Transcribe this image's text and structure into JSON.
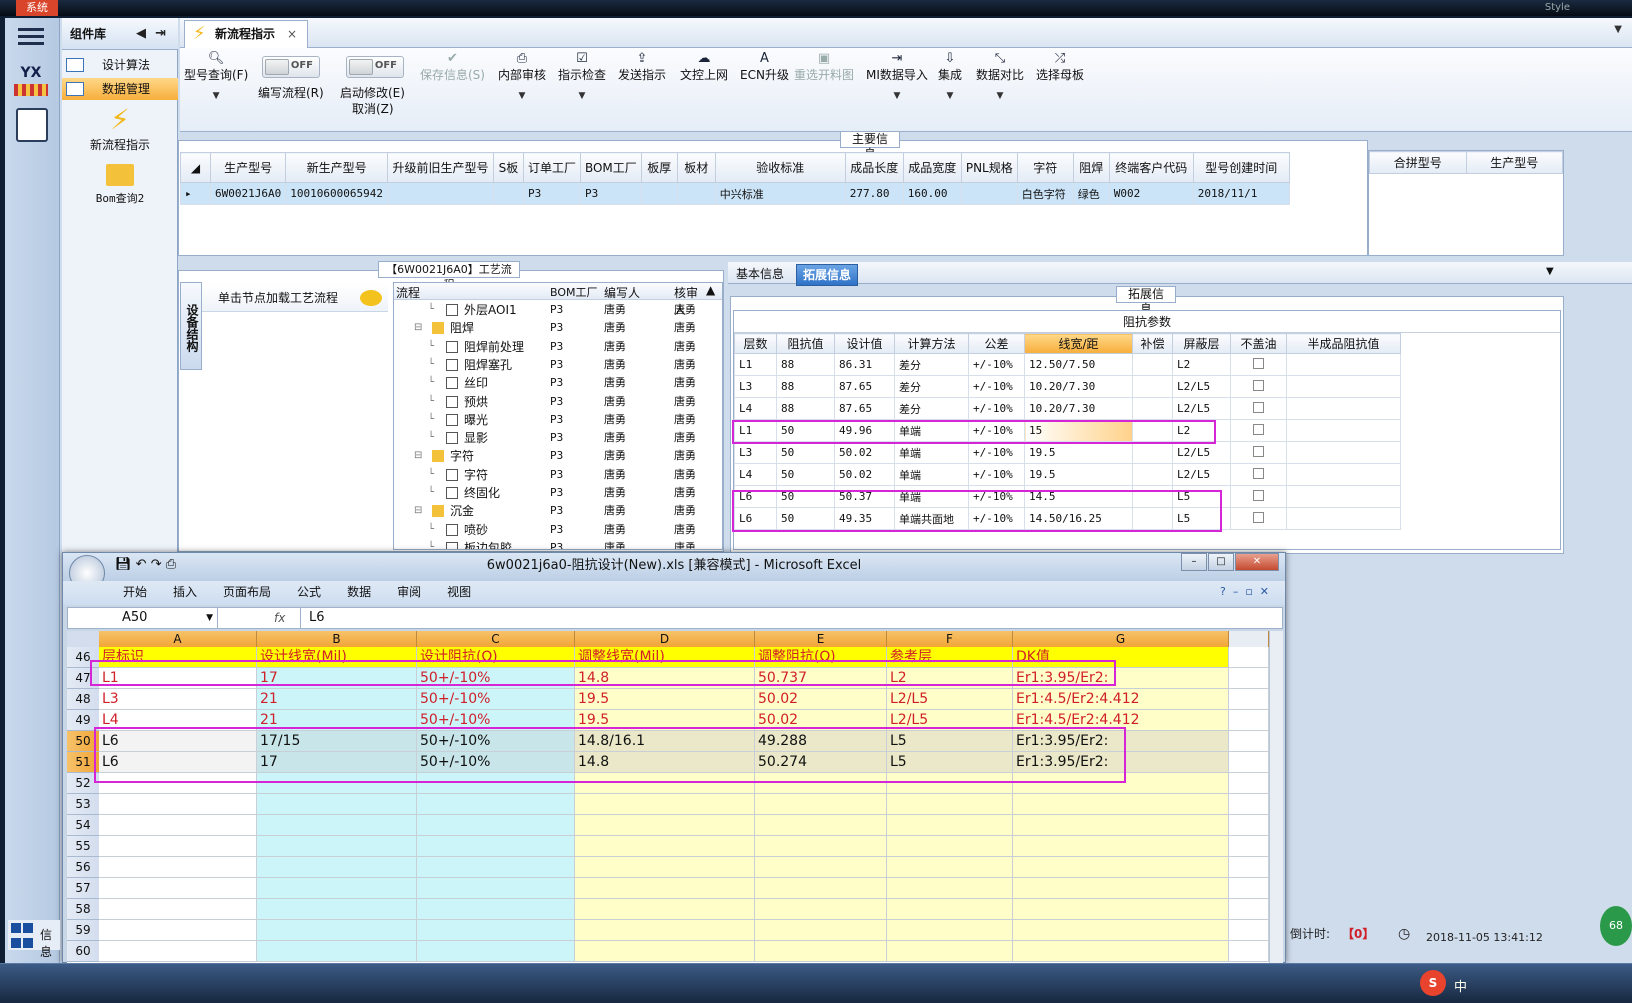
{
  "system_tag": "系统",
  "system_right": "Style",
  "left_rail": {
    "logo": "YX"
  },
  "component_lib": {
    "title": "组件库",
    "items": [
      {
        "label": "设计算法"
      },
      {
        "label": "数据管理"
      }
    ],
    "big_buttons": [
      {
        "label": "新流程指示"
      },
      {
        "label": "Bom查询2"
      }
    ]
  },
  "tab": {
    "label": "新流程指示",
    "close": "×"
  },
  "toolbar": {
    "buttons": [
      {
        "label": "型号查询(F)",
        "icon": "search-icon",
        "dropdown": true,
        "disabled": false
      },
      {
        "label": "保存信息(S)",
        "icon": "check-icon",
        "dropdown": false,
        "disabled": true
      },
      {
        "label": "内部审核",
        "icon": "print-icon",
        "dropdown": true,
        "disabled": false
      },
      {
        "label": "指示检查",
        "icon": "check-box-icon",
        "dropdown": true,
        "disabled": false
      },
      {
        "label": "发送指示",
        "icon": "upload-icon",
        "dropdown": false,
        "disabled": false
      },
      {
        "label": "文控上网",
        "icon": "cloud-upload-icon",
        "dropdown": false,
        "disabled": false
      },
      {
        "label": "ECN升级",
        "icon": "font-icon",
        "dropdown": false,
        "disabled": false
      },
      {
        "label": "重选开料图",
        "icon": "image-icon",
        "dropdown": false,
        "disabled": true
      },
      {
        "label": "MI数据导入",
        "icon": "import-icon",
        "dropdown": true,
        "disabled": false
      },
      {
        "label": "集成",
        "icon": "download-icon",
        "dropdown": true,
        "disabled": false
      },
      {
        "label": "数据对比",
        "icon": "compare-icon",
        "dropdown": true,
        "disabled": false
      },
      {
        "label": "选择母板",
        "icon": "shuffle-icon",
        "dropdown": false,
        "disabled": false
      }
    ],
    "toggles": [
      {
        "label": "编写流程(R)",
        "state": "OFF"
      },
      {
        "label": "启动修改(E)",
        "sub": "取消(Z)",
        "state": "OFF"
      }
    ]
  },
  "main_info": {
    "title": "主要信息",
    "columns": [
      "生产型号",
      "新生产型号",
      "升级前旧生产型号",
      "S板",
      "订单工厂",
      "BOM工厂",
      "板厚",
      "板材",
      "验收标准",
      "成品长度",
      "成品宽度",
      "PNL规格",
      "字符",
      "阻焊",
      "终端客户代码",
      "型号创建时间"
    ],
    "row": [
      "6W0021J6A0",
      "10010600065942",
      "",
      "",
      "P3",
      "P3",
      "",
      "",
      "中兴标准",
      "277.80",
      "160.00",
      "",
      "白色字符",
      "绿色",
      "W002",
      "2018/11/1"
    ],
    "side_columns": [
      "合拼型号",
      "生产型号"
    ]
  },
  "process": {
    "title": "【6W0021J6A0】工艺流程",
    "vertical_tab": "设备结构",
    "hint": "单击节点加载工艺流程",
    "tree_columns": [
      "流程",
      "BOM工厂",
      "编写人",
      "核审人"
    ],
    "rows": [
      {
        "name": "外层AOI1",
        "level": 2,
        "type": "doc",
        "bom": "P3",
        "writer": "唐勇",
        "reviewer": "唐勇"
      },
      {
        "name": "阻焊",
        "level": 1,
        "type": "folder",
        "bom": "P3",
        "writer": "唐勇",
        "reviewer": "唐勇"
      },
      {
        "name": "阻焊前处理",
        "level": 2,
        "type": "doc",
        "bom": "P3",
        "writer": "唐勇",
        "reviewer": "唐勇"
      },
      {
        "name": "阻焊塞孔",
        "level": 2,
        "type": "doc",
        "bom": "P3",
        "writer": "唐勇",
        "reviewer": "唐勇"
      },
      {
        "name": "丝印",
        "level": 2,
        "type": "doc",
        "bom": "P3",
        "writer": "唐勇",
        "reviewer": "唐勇"
      },
      {
        "name": "预烘",
        "level": 2,
        "type": "doc",
        "bom": "P3",
        "writer": "唐勇",
        "reviewer": "唐勇"
      },
      {
        "name": "曝光",
        "level": 2,
        "type": "doc",
        "bom": "P3",
        "writer": "唐勇",
        "reviewer": "唐勇"
      },
      {
        "name": "显影",
        "level": 2,
        "type": "doc",
        "bom": "P3",
        "writer": "唐勇",
        "reviewer": "唐勇"
      },
      {
        "name": "字符",
        "level": 1,
        "type": "folder",
        "bom": "P3",
        "writer": "唐勇",
        "reviewer": "唐勇"
      },
      {
        "name": "字符",
        "level": 2,
        "type": "doc",
        "bom": "P3",
        "writer": "唐勇",
        "reviewer": "唐勇"
      },
      {
        "name": "终固化",
        "level": 2,
        "type": "doc",
        "bom": "P3",
        "writer": "唐勇",
        "reviewer": "唐勇"
      },
      {
        "name": "沉金",
        "level": 1,
        "type": "folder",
        "bom": "P3",
        "writer": "唐勇",
        "reviewer": "唐勇"
      },
      {
        "name": "喷砂",
        "level": 2,
        "type": "doc",
        "bom": "P3",
        "writer": "唐勇",
        "reviewer": "唐勇"
      },
      {
        "name": "板边包胶",
        "level": 2,
        "type": "doc",
        "bom": "P3",
        "writer": "唐勇",
        "reviewer": "唐勇"
      }
    ]
  },
  "extended": {
    "tabs": [
      "基本信息",
      "拓展信息"
    ],
    "active_tab": 1,
    "title": "拓展信息",
    "impedance_title": "阻抗参数",
    "columns": [
      "层数",
      "阻抗值",
      "设计值",
      "计算方法",
      "公差",
      "线宽/距",
      "补偿",
      "屏蔽层",
      "不盖油",
      "半成品阻抗值"
    ],
    "rows": [
      [
        "L1",
        "88",
        "86.31",
        "差分",
        "+/-10%",
        "12.50/7.50",
        "",
        "L2"
      ],
      [
        "L3",
        "88",
        "87.65",
        "差分",
        "+/-10%",
        "10.20/7.30",
        "",
        "L2/L5"
      ],
      [
        "L4",
        "88",
        "87.65",
        "差分",
        "+/-10%",
        "10.20/7.30",
        "",
        "L2/L5"
      ],
      [
        "L1",
        "50",
        "49.96",
        "单端",
        "+/-10%",
        "15",
        "",
        "L2"
      ],
      [
        "L3",
        "50",
        "50.02",
        "单端",
        "+/-10%",
        "19.5",
        "",
        "L2/L5"
      ],
      [
        "L4",
        "50",
        "50.02",
        "单端",
        "+/-10%",
        "19.5",
        "",
        "L2/L5"
      ],
      [
        "L6",
        "50",
        "50.37",
        "单端",
        "+/-10%",
        "14.5",
        "",
        "L5"
      ],
      [
        "L6",
        "50",
        "49.35",
        "单端共面地",
        "+/-10%",
        "14.50/16.25",
        "",
        "L5"
      ]
    ]
  },
  "excel": {
    "title": "6w0021j6a0-阻抗设计(New).xls  [兼容模式] - Microsoft Excel",
    "menu": [
      "开始",
      "插入",
      "页面布局",
      "公式",
      "数据",
      "审阅",
      "视图"
    ],
    "name_box": "A50",
    "fx": "fx",
    "formula": "L6",
    "col_letters": [
      "A",
      "B",
      "C",
      "D",
      "E",
      "F",
      "G"
    ],
    "rows": [
      {
        "num": "46",
        "cells": [
          "层标识",
          "设计线宽(Mil)",
          "设计阻抗(Ω)",
          "调整线宽(Mil)",
          "调整阻抗(Ω)",
          "参考层",
          "DK值"
        ]
      },
      {
        "num": "47",
        "cells": [
          "L1",
          "17",
          "50+/-10%",
          "14.8",
          "50.737",
          "L2",
          "Er1:3.95/Er2:"
        ]
      },
      {
        "num": "48",
        "cells": [
          "L3",
          "21",
          "50+/-10%",
          "19.5",
          "50.02",
          "L2/L5",
          "Er1:4.5/Er2:4.412"
        ]
      },
      {
        "num": "49",
        "cells": [
          "L4",
          "21",
          "50+/-10%",
          "19.5",
          "50.02",
          "L2/L5",
          "Er1:4.5/Er2:4.412"
        ]
      },
      {
        "num": "50",
        "cells": [
          "L6",
          "17/15",
          "50+/-10%",
          "14.8/16.1",
          "49.288",
          "L5",
          "Er1:3.95/Er2:"
        ]
      },
      {
        "num": "51",
        "cells": [
          "L6",
          "17",
          "50+/-10%",
          "14.8",
          "50.274",
          "L5",
          "Er1:3.95/Er2:"
        ]
      },
      {
        "num": "52",
        "cells": [
          "",
          "",
          "",
          "",
          "",
          "",
          ""
        ]
      },
      {
        "num": "53",
        "cells": [
          "",
          "",
          "",
          "",
          "",
          "",
          ""
        ]
      },
      {
        "num": "54",
        "cells": [
          "",
          "",
          "",
          "",
          "",
          "",
          ""
        ]
      },
      {
        "num": "55",
        "cells": [
          "",
          "",
          "",
          "",
          "",
          "",
          ""
        ]
      },
      {
        "num": "56",
        "cells": [
          "",
          "",
          "",
          "",
          "",
          "",
          ""
        ]
      },
      {
        "num": "57",
        "cells": [
          "",
          "",
          "",
          "",
          "",
          "",
          ""
        ]
      },
      {
        "num": "58",
        "cells": [
          "",
          "",
          "",
          "",
          "",
          "",
          ""
        ]
      },
      {
        "num": "59",
        "cells": [
          "",
          "",
          "",
          "",
          "",
          "",
          ""
        ]
      },
      {
        "num": "60",
        "cells": [
          "",
          "",
          "",
          "",
          "",
          "",
          ""
        ]
      }
    ]
  },
  "status": {
    "countdown_label": "倒计时:",
    "countdown_value": "【0】",
    "datetime": "2018-11-05 13:41:12",
    "info_label": "信息"
  },
  "ime": {
    "label": "中"
  },
  "colors": {
    "accent": "#f7ae3b",
    "highlight": "#d625d6",
    "excel_header": "#f1a536",
    "red_text": "#d0202a"
  }
}
